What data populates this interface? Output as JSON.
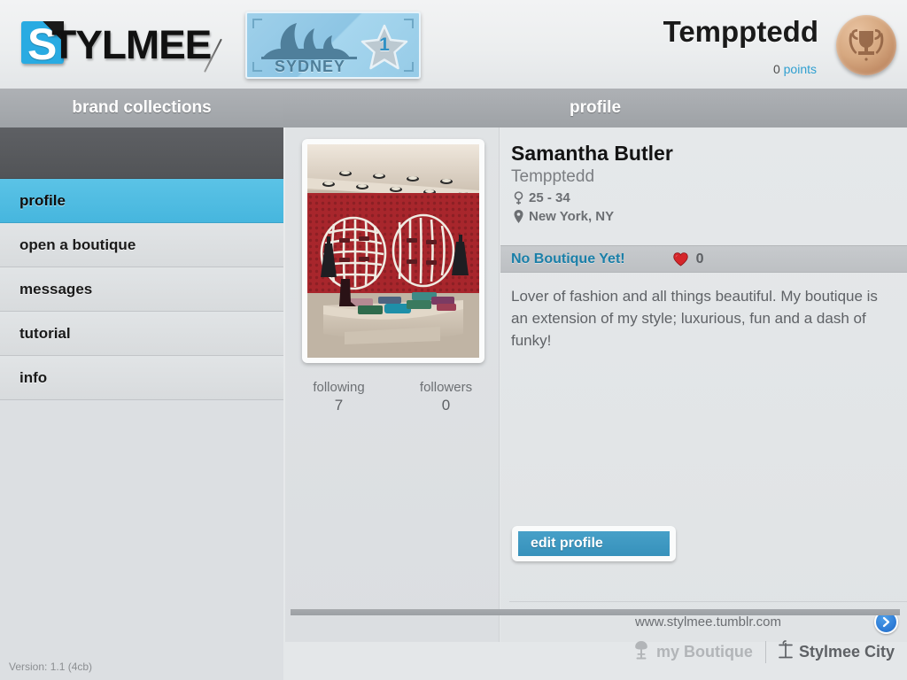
{
  "topbar": {
    "logo_letter": "S",
    "logo_text": "TYLMEE",
    "city_badge": {
      "name": "SYDNEY",
      "level": "1",
      "icon": "sydney-opera-house-icon"
    },
    "username": "Tempptedd",
    "points_value": "0",
    "points_label": "points",
    "medal": "bronze-trophy-medal"
  },
  "sidebar": {
    "header": "brand collections",
    "items": [
      {
        "label": "profile",
        "active": true
      },
      {
        "label": "open a boutique",
        "active": false
      },
      {
        "label": "messages",
        "active": false
      },
      {
        "label": "tutorial",
        "active": false
      },
      {
        "label": "info",
        "active": false
      }
    ],
    "version": "Version: 1.1 (4cb)"
  },
  "main": {
    "header": "profile",
    "photo_alt": "virtual-boutique-interior",
    "stats": [
      {
        "label": "following",
        "value": "7"
      },
      {
        "label": "followers",
        "value": "0"
      }
    ],
    "profile": {
      "real_name": "Samantha Butler",
      "handle": "Tempptedd",
      "gender_icon": "female-venus-icon",
      "age_range": "25 - 34",
      "location_icon": "map-pin-icon",
      "location": "New York, NY",
      "boutique_status": "No Boutique Yet!",
      "likes_icon": "heart-icon",
      "likes_count": "0",
      "bio": "Lover of fashion and all things beautiful.  My boutique is an extension of my style; luxurious, fun and a dash of funky!",
      "url": "www.stylmee.tumblr.com",
      "url_go_icon": "chevron-right-circle-icon"
    },
    "edit_button": "edit profile"
  },
  "bottom_nav": [
    {
      "label": "my Boutique",
      "icon": "mannequin-icon",
      "active": false
    },
    {
      "label": "Stylmee City",
      "icon": "clothes-hanger-icon",
      "active": true
    }
  ],
  "colors": {
    "accent_blue": "#46b6de",
    "link_blue": "#2f9fd0",
    "boutique_teal": "#1a7fa8",
    "heart_red": "#d5262a",
    "header_gray": "#a3a7ab"
  }
}
